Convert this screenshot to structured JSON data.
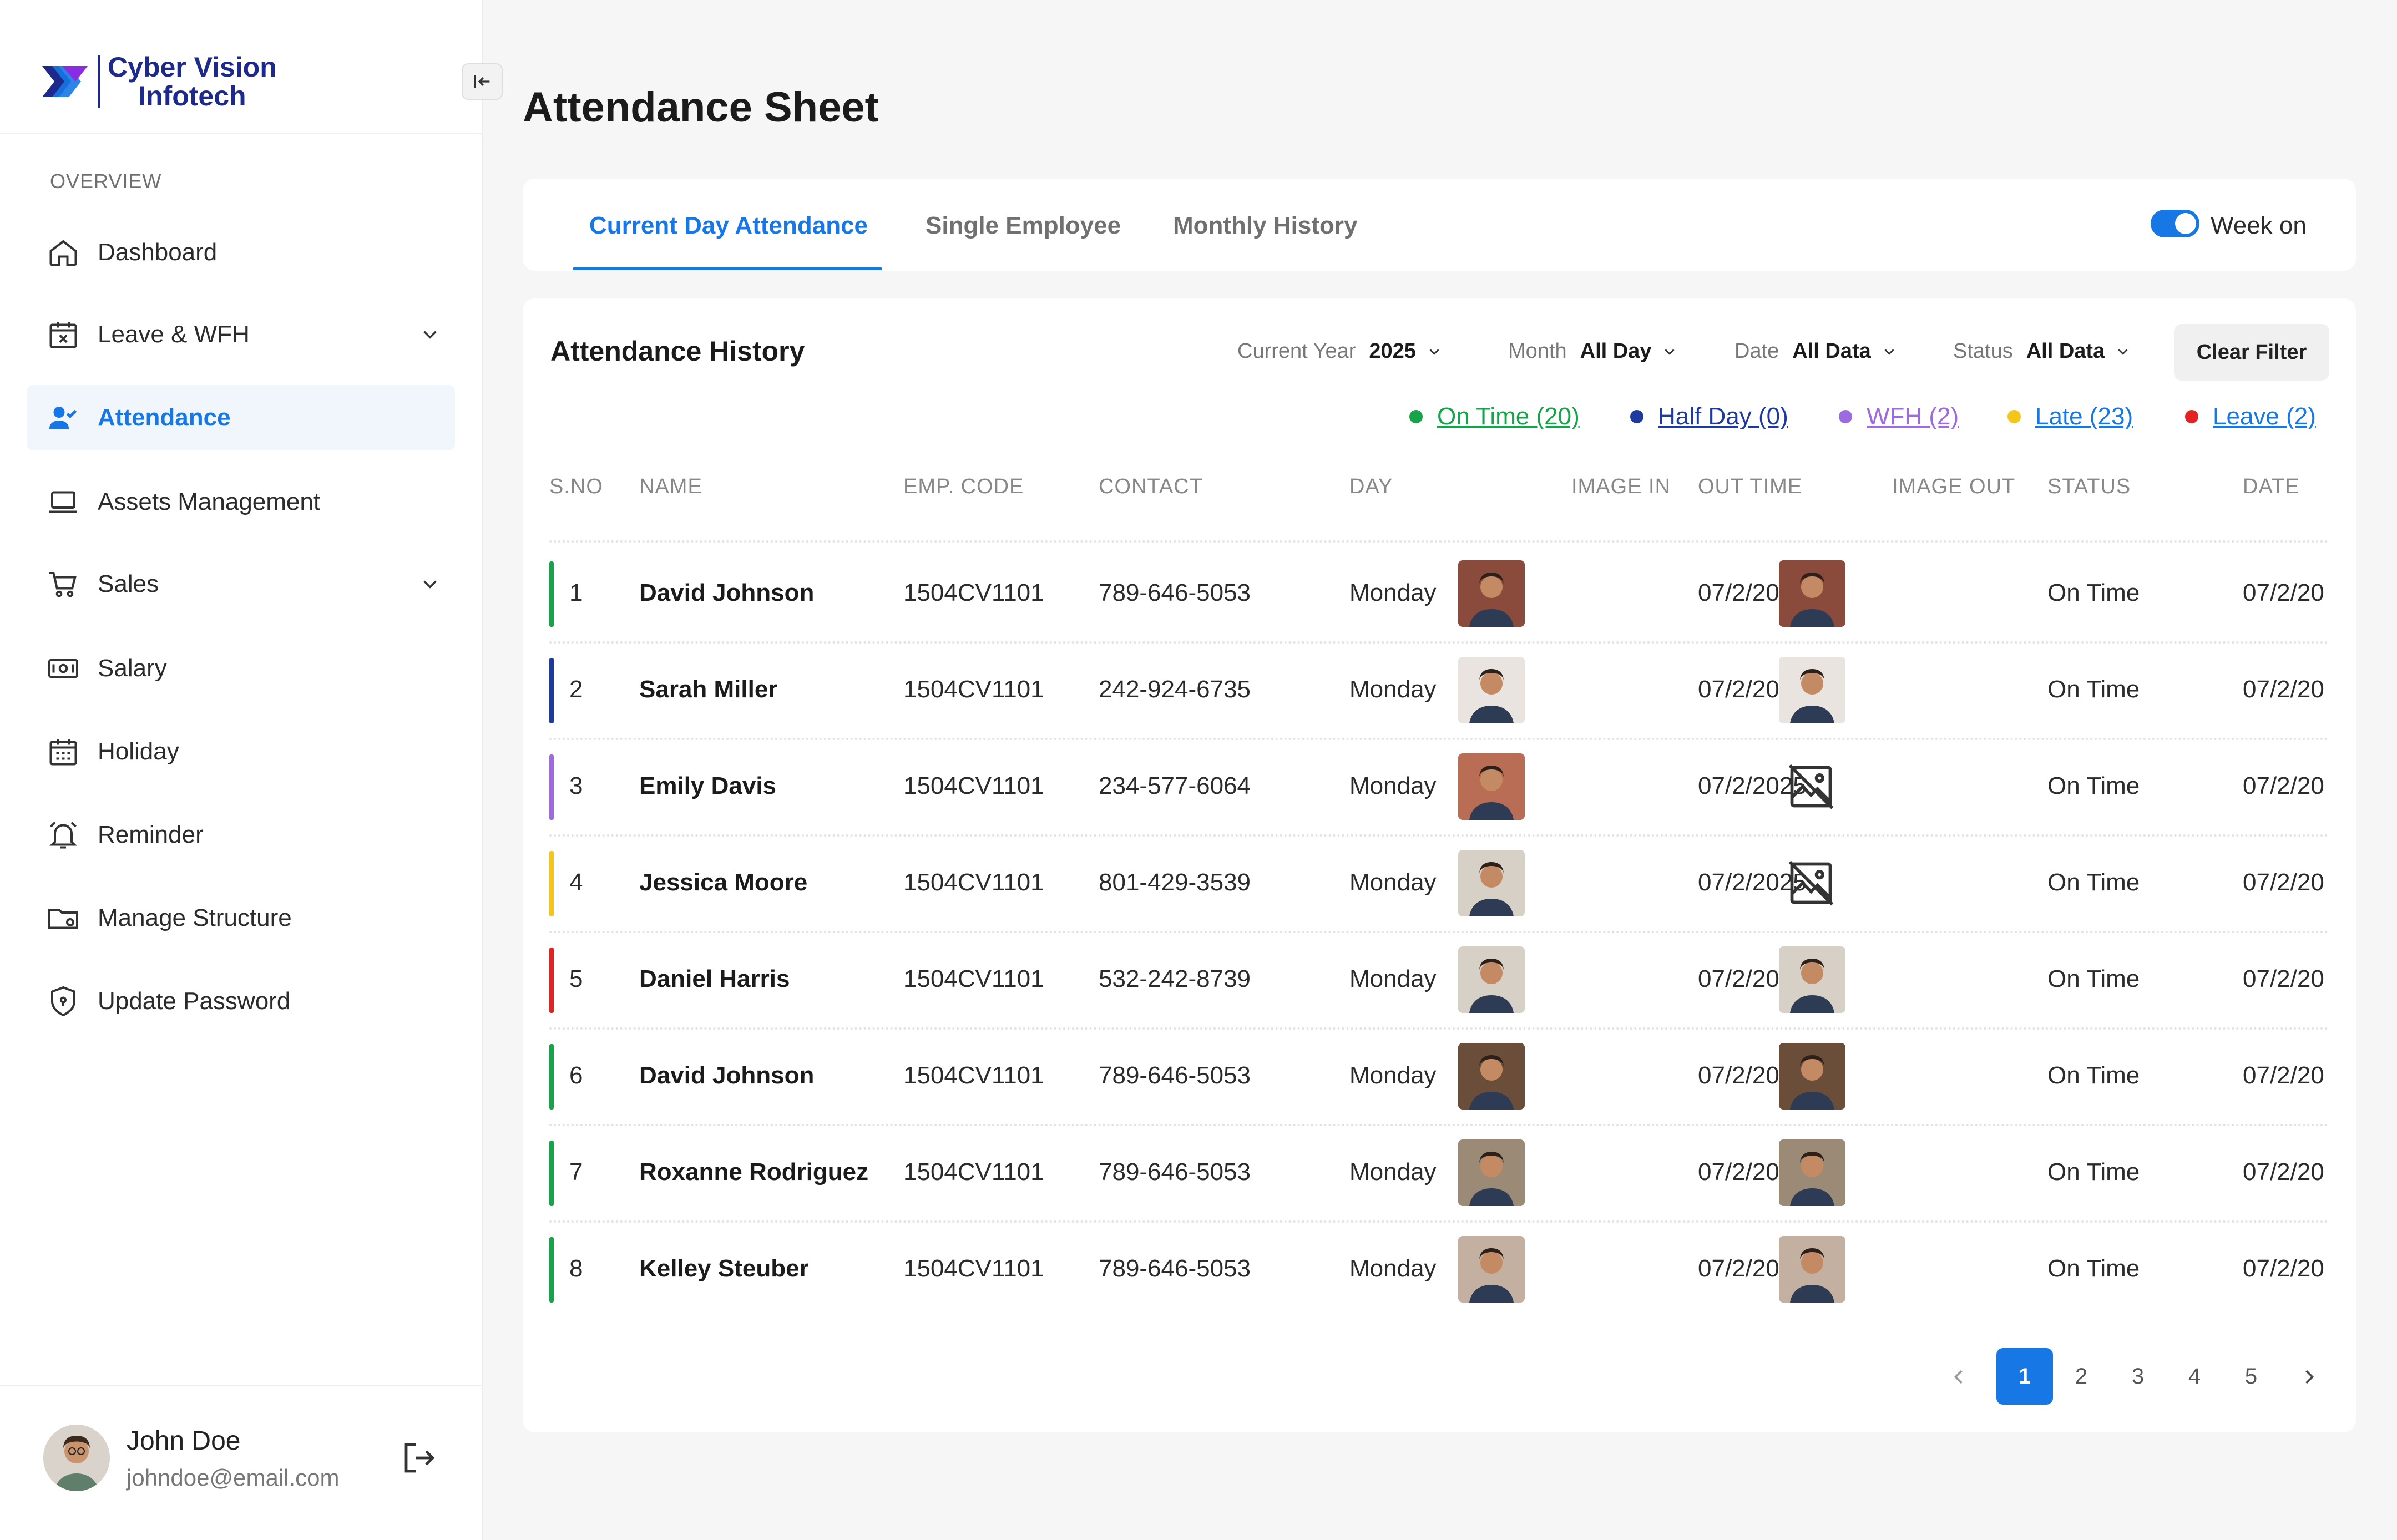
{
  "app": {
    "logo_line1": "Cyber Vision",
    "logo_line2": "Infotech"
  },
  "sidebar": {
    "section_label": "OVERVIEW",
    "items": [
      {
        "label": "Dashboard",
        "icon": "home-icon"
      },
      {
        "label": "Leave & WFH",
        "icon": "calendar-x-icon",
        "expandable": true
      },
      {
        "label": "Attendance",
        "icon": "user-check-icon",
        "active": true
      },
      {
        "label": "Assets Management",
        "icon": "laptop-icon"
      },
      {
        "label": "Sales",
        "icon": "cart-icon",
        "expandable": true
      },
      {
        "label": "Salary",
        "icon": "money-icon"
      },
      {
        "label": "Holiday",
        "icon": "calendar-icon"
      },
      {
        "label": "Reminder",
        "icon": "bell-icon"
      },
      {
        "label": "Manage Structure",
        "icon": "folder-gear-icon"
      },
      {
        "label": "Update Password",
        "icon": "shield-icon"
      }
    ],
    "user": {
      "name": "John Doe",
      "email": "johndoe@email.com"
    }
  },
  "page": {
    "title": "Attendance Sheet"
  },
  "tabs": [
    {
      "label": "Current Day Attendance",
      "active": true
    },
    {
      "label": "Single Employee"
    },
    {
      "label": "Monthly History"
    }
  ],
  "toggle": {
    "label": "Week on",
    "on": true
  },
  "card": {
    "title": "Attendance History",
    "clear_filter": "Clear Filter"
  },
  "filters": [
    {
      "label": "Current Year",
      "value": "2025"
    },
    {
      "label": "Month",
      "value": "All Day"
    },
    {
      "label": "Date",
      "value": "All Data"
    },
    {
      "label": "Status",
      "value": "All Data"
    }
  ],
  "legend": [
    {
      "label": "On Time (20)",
      "color": "#16a34a"
    },
    {
      "label": "Half Day (0)",
      "color": "#1e3a9e"
    },
    {
      "label": "WFH (2)",
      "color": "#9b6bdf"
    },
    {
      "label": "Late (23)",
      "color": "#f5c518"
    },
    {
      "label": "Leave (2)",
      "color": "#e02424"
    }
  ],
  "columns": [
    "S.NO",
    "NAME",
    "EMP. CODE",
    "CONTACT",
    "DAY",
    "IMAGE IN",
    "OUT TIME",
    "IMAGE OUT",
    "STATUS",
    "DATE"
  ],
  "rows": [
    {
      "sno": "1",
      "name": "David Johnson",
      "code": "1504CV1101",
      "contact": "789-646-5053",
      "day": "Monday",
      "out_time": "07/2/2025",
      "status": "On Time",
      "date": "07/2/20",
      "bar": "#16a34a",
      "img_in": true,
      "img_out": true,
      "tone": "#8a4a3c"
    },
    {
      "sno": "2",
      "name": "Sarah Miller",
      "code": "1504CV1101",
      "contact": "242-924-6735",
      "day": "Monday",
      "out_time": "07/2/2025",
      "status": "On Time",
      "date": "07/2/20",
      "bar": "#1e3a9e",
      "img_in": true,
      "img_out": true,
      "tone": "#e9e4df"
    },
    {
      "sno": "3",
      "name": "Emily Davis",
      "code": "1504CV1101",
      "contact": "234-577-6064",
      "day": "Monday",
      "out_time": "07/2/2025",
      "status": "On Time",
      "date": "07/2/20",
      "bar": "#9b6bdf",
      "img_in": true,
      "img_out": false,
      "tone": "#b86d54"
    },
    {
      "sno": "4",
      "name": "Jessica Moore",
      "code": "1504CV1101",
      "contact": "801-429-3539",
      "day": "Monday",
      "out_time": "07/2/2025",
      "status": "On Time",
      "date": "07/2/20",
      "bar": "#f5c518",
      "img_in": true,
      "img_out": false,
      "tone": "#d7d0c6"
    },
    {
      "sno": "5",
      "name": "Daniel Harris",
      "code": "1504CV1101",
      "contact": "532-242-8739",
      "day": "Monday",
      "out_time": "07/2/2025",
      "status": "On Time",
      "date": "07/2/20",
      "bar": "#e02424",
      "img_in": true,
      "img_out": true,
      "tone": "#d7d0c6"
    },
    {
      "sno": "6",
      "name": "David Johnson",
      "code": "1504CV1101",
      "contact": "789-646-5053",
      "day": "Monday",
      "out_time": "07/2/2025",
      "status": "On Time",
      "date": "07/2/20",
      "bar": "#16a34a",
      "img_in": true,
      "img_out": true,
      "tone": "#6b4e3a"
    },
    {
      "sno": "7",
      "name": "Roxanne Rodriguez",
      "code": "1504CV1101",
      "contact": "789-646-5053",
      "day": "Monday",
      "out_time": "07/2/2025",
      "status": "On Time",
      "date": "07/2/20",
      "bar": "#16a34a",
      "img_in": true,
      "img_out": true,
      "tone": "#9a8a76"
    },
    {
      "sno": "8",
      "name": "Kelley Steuber",
      "code": "1504CV1101",
      "contact": "789-646-5053",
      "day": "Monday",
      "out_time": "07/2/2025",
      "status": "On Time",
      "date": "07/2/20",
      "bar": "#16a34a",
      "img_in": true,
      "img_out": true,
      "tone": "#c4b0a0"
    }
  ],
  "pagination": {
    "pages": [
      "1",
      "2",
      "3",
      "4",
      "5"
    ],
    "current": "1"
  }
}
